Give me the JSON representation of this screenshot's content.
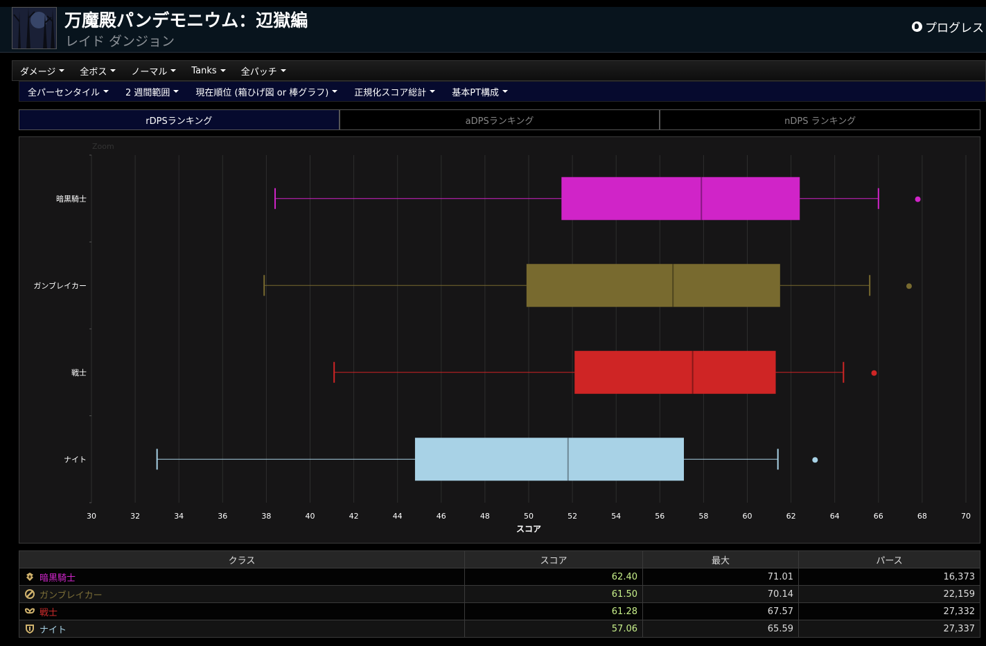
{
  "header": {
    "title": "万魔殿パンデモニウム：辺獄編",
    "subtitle": "レイド ダンジョン",
    "progress_link": "プログレス"
  },
  "filters_row1": [
    "ダメージ",
    "全ボス",
    "ノーマル",
    "Tanks",
    "全パッチ"
  ],
  "filters_row2": [
    "全パーセンタイル",
    "2 週間範囲",
    "現在順位 (箱ひげ図 or 棒グラフ)",
    "正規化スコア総計",
    "基本PT構成"
  ],
  "tabs": [
    "rDPSランキング",
    "aDPSランキング",
    "nDPS ランキング"
  ],
  "active_tab": 0,
  "chart_data": {
    "type": "boxplot",
    "zoom_label": "Zoom",
    "xlabel": "スコア",
    "xlim": [
      30,
      70
    ],
    "xticks": [
      30,
      32,
      34,
      36,
      38,
      40,
      42,
      44,
      46,
      48,
      50,
      52,
      54,
      56,
      58,
      60,
      62,
      64,
      66,
      68,
      70
    ],
    "grid": true,
    "series": [
      {
        "name": "暗黒騎士",
        "color": "#d024c8",
        "min": 38.4,
        "q1": 51.5,
        "median": 57.9,
        "q3": 62.4,
        "max": 66.0,
        "outlier": 67.8
      },
      {
        "name": "ガンブレイカー",
        "color": "#786a2f",
        "min": 37.9,
        "q1": 49.9,
        "median": 56.6,
        "q3": 61.5,
        "max": 65.6,
        "outlier": 67.4
      },
      {
        "name": "戦士",
        "color": "#cf2525",
        "min": 41.1,
        "q1": 52.1,
        "median": 57.5,
        "q3": 61.3,
        "max": 64.4,
        "outlier": 65.8
      },
      {
        "name": "ナイト",
        "color": "#a8d2e6",
        "min": 33.0,
        "q1": 44.8,
        "median": 51.8,
        "q3": 57.1,
        "max": 61.4,
        "outlier": 63.1
      }
    ]
  },
  "table": {
    "headers": [
      "クラス",
      "スコア",
      "最大",
      "パース"
    ],
    "rows": [
      {
        "class": "暗黒騎士",
        "color": "#d126cc",
        "icon": "dark-knight-icon",
        "score": "62.40",
        "max": "71.01",
        "parses": "16,373"
      },
      {
        "class": "ガンブレイカー",
        "color": "#7d6f38",
        "icon": "gunbreaker-icon",
        "score": "61.50",
        "max": "70.14",
        "parses": "22,159"
      },
      {
        "class": "戦士",
        "color": "#cc2b2b",
        "icon": "warrior-icon",
        "score": "61.28",
        "max": "67.57",
        "parses": "27,332"
      },
      {
        "class": "ナイト",
        "color": "#a8d2e6",
        "icon": "paladin-icon",
        "score": "57.06",
        "max": "65.59",
        "parses": "27,337"
      }
    ]
  }
}
